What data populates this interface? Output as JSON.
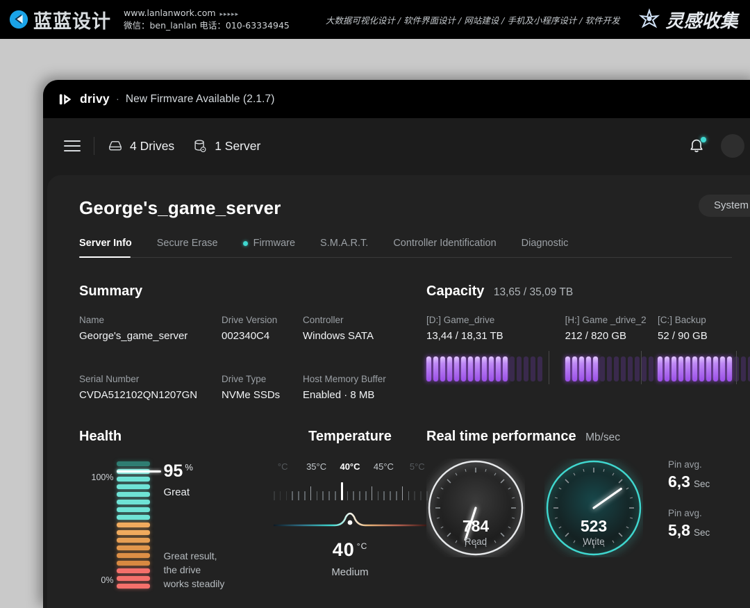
{
  "banner": {
    "brand_cn": "蓝蓝设计",
    "website": "www.lanlanwork.com",
    "dots": "▸▸▸▸▸",
    "wechat_line": "微信：ben_lanlan    电话：010-63334945",
    "services": "大数据可视化设计 / 软件界面设计 / 网站建设 / 手机及小程序设计 / 软件开发",
    "right_text": "灵感收集"
  },
  "titlebar": {
    "app_name": "drivy",
    "separator": "·",
    "firmware_note": "New Firmvare Available (2.1.7)",
    "logo_icon": "drivy-logo-icon"
  },
  "toolbar": {
    "menu_icon": "hamburger-menu-icon",
    "drives_icon": "drive-icon",
    "drives_label": "4 Drives",
    "server_icon": "server-icon",
    "server_label": "1 Server",
    "bell_icon": "notification-bell-icon",
    "avatar": "user-avatar"
  },
  "page": {
    "title": "George's_game_server",
    "system_pill": "System"
  },
  "tabs": [
    {
      "label": "Server Info",
      "active": true,
      "dot": false
    },
    {
      "label": "Secure Erase",
      "active": false,
      "dot": false
    },
    {
      "label": "Firmware",
      "active": false,
      "dot": true
    },
    {
      "label": "S.M.A.R.T.",
      "active": false,
      "dot": false
    },
    {
      "label": "Controller Identification",
      "active": false,
      "dot": false
    },
    {
      "label": "Diagnostic",
      "active": false,
      "dot": false
    }
  ],
  "summary": {
    "title": "Summary",
    "fields": {
      "name_key": "Name",
      "name_val": "George's_game_server",
      "drive_version_key": "Drive Version",
      "drive_version_val": "002340C4",
      "controller_key": "Controller",
      "controller_val": "Windows SATA",
      "serial_key": "Serial Number",
      "serial_val": "CVDA512102QN1207GN",
      "drive_type_key": "Drive Type",
      "drive_type_val": "NVMe SSDs",
      "hmb_key": "Host Memory Buffer",
      "hmb_val": "Enabled  ·  8 MB"
    }
  },
  "capacity": {
    "title": "Capacity",
    "total": "13,65 / 35,09 TB",
    "drives": [
      {
        "name": "[D:] Game_drive",
        "value": "13,44 / 18,31 TB",
        "bars_total": 17,
        "bars_on": 12
      },
      {
        "name": "[H:] Game _drive_2",
        "value": "212 / 820 GB",
        "bars_total": 13,
        "bars_on": 5
      },
      {
        "name": "[C:] Backup",
        "value": "52 / 90 GB",
        "bars_total": 14,
        "bars_on": 11
      }
    ]
  },
  "health": {
    "title": "Health",
    "top_label": "100%",
    "bottom_label": "0%",
    "percent": "95",
    "percent_unit": "%",
    "status": "Great",
    "note": "Great result,\nthe drive\nworks steadily",
    "bars_total": 17,
    "marker_index": 1
  },
  "temperature": {
    "title": "Temperature",
    "ticks": [
      "°C",
      "35°C",
      "40°C",
      "45°C",
      "5°C"
    ],
    "value": "40",
    "unit": "°C",
    "state": "Medium"
  },
  "performance": {
    "title": "Real time performance",
    "unit": "Mb/sec",
    "gauges": [
      {
        "value": "784",
        "label": "Read",
        "accent": "#e8eaec",
        "needle_deg": 108
      },
      {
        "value": "523",
        "label": "Write",
        "accent": "#3fd8d0",
        "needle_deg": -35
      }
    ],
    "pins": [
      {
        "key": "Pin avg.",
        "value": "6,3",
        "unit": "Sec"
      },
      {
        "key": "Pin avg.",
        "value": "5,8",
        "unit": "Sec"
      }
    ]
  },
  "colors": {
    "accent_teal": "#3fd8d0",
    "capacity_purple": "#a855f7",
    "page_bg": "#c9c9c9",
    "panel_bg": "#222222",
    "window_bg": "#1c1c1c"
  }
}
